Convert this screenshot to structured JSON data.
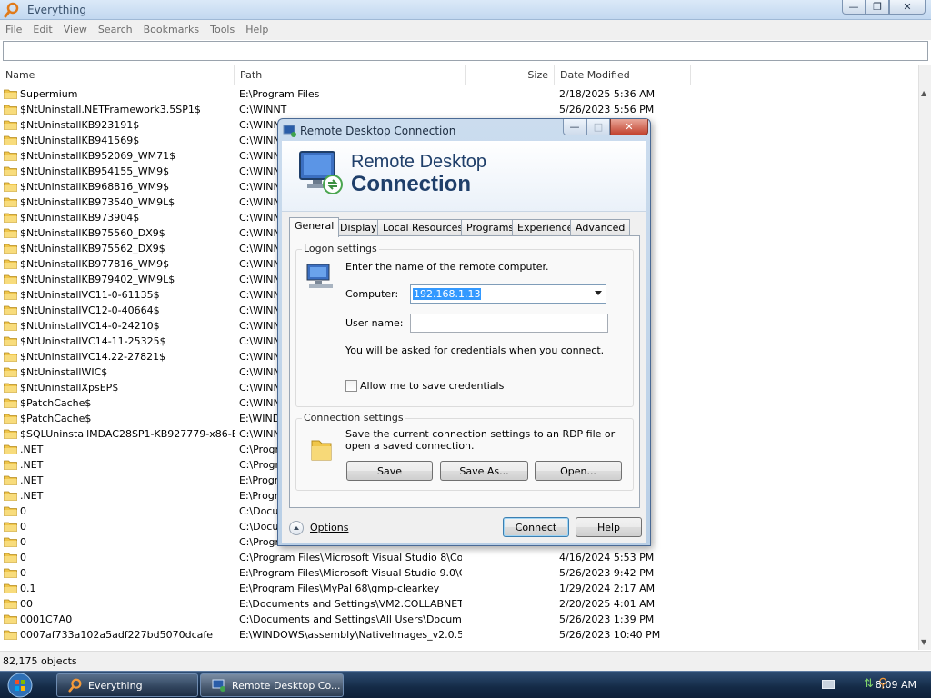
{
  "everything": {
    "title": "Everything",
    "menu": [
      "File",
      "Edit",
      "View",
      "Search",
      "Bookmarks",
      "Tools",
      "Help"
    ],
    "search_value": "",
    "columns": {
      "name": "Name",
      "path": "Path",
      "size": "Size",
      "date": "Date Modified"
    },
    "rows": [
      {
        "name": "Supermium",
        "path": "E:\\Program Files",
        "size": "",
        "date": "2/18/2025 5:36 AM"
      },
      {
        "name": "$NtUninstall.NETFramework3.5SP1$",
        "path": "C:\\WINNT",
        "size": "",
        "date": "5/26/2023 5:56 PM"
      },
      {
        "name": "$NtUninstallKB923191$",
        "path": "C:\\WINNT",
        "size": "",
        "date": ""
      },
      {
        "name": "$NtUninstallKB941569$",
        "path": "C:\\WINNT",
        "size": "",
        "date": ""
      },
      {
        "name": "$NtUninstallKB952069_WM71$",
        "path": "C:\\WINNT",
        "size": "",
        "date": ""
      },
      {
        "name": "$NtUninstallKB954155_WM9$",
        "path": "C:\\WINNT",
        "size": "",
        "date": ""
      },
      {
        "name": "$NtUninstallKB968816_WM9$",
        "path": "C:\\WINNT",
        "size": "",
        "date": ""
      },
      {
        "name": "$NtUninstallKB973540_WM9L$",
        "path": "C:\\WINNT",
        "size": "",
        "date": ""
      },
      {
        "name": "$NtUninstallKB973904$",
        "path": "C:\\WINNT",
        "size": "",
        "date": ""
      },
      {
        "name": "$NtUninstallKB975560_DX9$",
        "path": "C:\\WINNT",
        "size": "",
        "date": ""
      },
      {
        "name": "$NtUninstallKB975562_DX9$",
        "path": "C:\\WINNT",
        "size": "",
        "date": ""
      },
      {
        "name": "$NtUninstallKB977816_WM9$",
        "path": "C:\\WINNT",
        "size": "",
        "date": ""
      },
      {
        "name": "$NtUninstallKB979402_WM9L$",
        "path": "C:\\WINNT",
        "size": "",
        "date": ""
      },
      {
        "name": "$NtUninstallVC11-0-61135$",
        "path": "C:\\WINNT",
        "size": "",
        "date": ""
      },
      {
        "name": "$NtUninstallVC12-0-40664$",
        "path": "C:\\WINNT",
        "size": "",
        "date": ""
      },
      {
        "name": "$NtUninstallVC14-0-24210$",
        "path": "C:\\WINNT",
        "size": "",
        "date": ""
      },
      {
        "name": "$NtUninstallVC14-11-25325$",
        "path": "C:\\WINNT",
        "size": "",
        "date": ""
      },
      {
        "name": "$NtUninstallVC14.22-27821$",
        "path": "C:\\WINNT",
        "size": "",
        "date": ""
      },
      {
        "name": "$NtUninstallWIC$",
        "path": "C:\\WINNT",
        "size": "",
        "date": ""
      },
      {
        "name": "$NtUninstallXpsEP$",
        "path": "C:\\WINNT",
        "size": "",
        "date": ""
      },
      {
        "name": "$PatchCache$",
        "path": "C:\\WINNT",
        "size": "",
        "date": ""
      },
      {
        "name": "$PatchCache$",
        "path": "E:\\WINDOWS",
        "size": "",
        "date": ""
      },
      {
        "name": "$SQLUninstallMDAC28SP1-KB927779-x86-E...",
        "path": "C:\\WINNT",
        "size": "",
        "date": ""
      },
      {
        "name": ".NET",
        "path": "C:\\Program",
        "size": "",
        "date": ""
      },
      {
        "name": ".NET",
        "path": "C:\\Program",
        "size": "",
        "date": ""
      },
      {
        "name": ".NET",
        "path": "E:\\Program",
        "size": "",
        "date": ""
      },
      {
        "name": ".NET",
        "path": "E:\\Program",
        "size": "",
        "date": ""
      },
      {
        "name": "0",
        "path": "C:\\Documents",
        "size": "",
        "date": ""
      },
      {
        "name": "0",
        "path": "C:\\Documents",
        "size": "",
        "date": ""
      },
      {
        "name": "0",
        "path": "C:\\Program",
        "size": "",
        "date": ""
      },
      {
        "name": "0",
        "path": "C:\\Program Files\\Microsoft Visual Studio 8\\Co...",
        "size": "",
        "date": "4/16/2024 5:53 PM"
      },
      {
        "name": "0",
        "path": "E:\\Program Files\\Microsoft Visual Studio 9.0\\C...",
        "size": "",
        "date": "5/26/2023 9:42 PM"
      },
      {
        "name": "0.1",
        "path": "E:\\Program Files\\MyPal 68\\gmp-clearkey",
        "size": "",
        "date": "1/29/2024 2:17 AM"
      },
      {
        "name": "00",
        "path": "E:\\Documents and Settings\\VM2.COLLABNET.0...",
        "size": "",
        "date": "2/20/2025 4:01 AM"
      },
      {
        "name": "0001C7A0",
        "path": "C:\\Documents and Settings\\All Users\\Docume...",
        "size": "",
        "date": "5/26/2023 1:39 PM"
      },
      {
        "name": "0007af733a102a5adf227bd5070dcafe",
        "path": "E:\\WINDOWS\\assembly\\NativeImages_v2.0.507...",
        "size": "",
        "date": "5/26/2023 10:40 PM"
      }
    ],
    "status": "82,175 objects"
  },
  "rdc": {
    "title": "Remote Desktop Connection",
    "banner_line1": "Remote Desktop",
    "banner_line2": "Connection",
    "tabs": [
      "General",
      "Display",
      "Local Resources",
      "Programs",
      "Experience",
      "Advanced"
    ],
    "logon_group": "Logon settings",
    "logon_hint": "Enter the name of the remote computer.",
    "computer_label": "Computer:",
    "computer_value": "192.168.1.13",
    "username_label": "User name:",
    "username_value": "",
    "credentials_note": "You will be asked for credentials when you connect.",
    "allow_save_label": "Allow me to save credentials",
    "allow_save_checked": false,
    "conn_group": "Connection settings",
    "conn_desc": "Save the current connection settings to an RDP file or open a saved connection.",
    "save_button": "Save",
    "save_as_button": "Save As...",
    "open_button": "Open...",
    "options_label": "Options",
    "connect_button": "Connect",
    "help_button": "Help"
  },
  "taskbar": {
    "items": [
      "Everything",
      "Remote Desktop Co..."
    ],
    "clock": "8:09 AM"
  }
}
